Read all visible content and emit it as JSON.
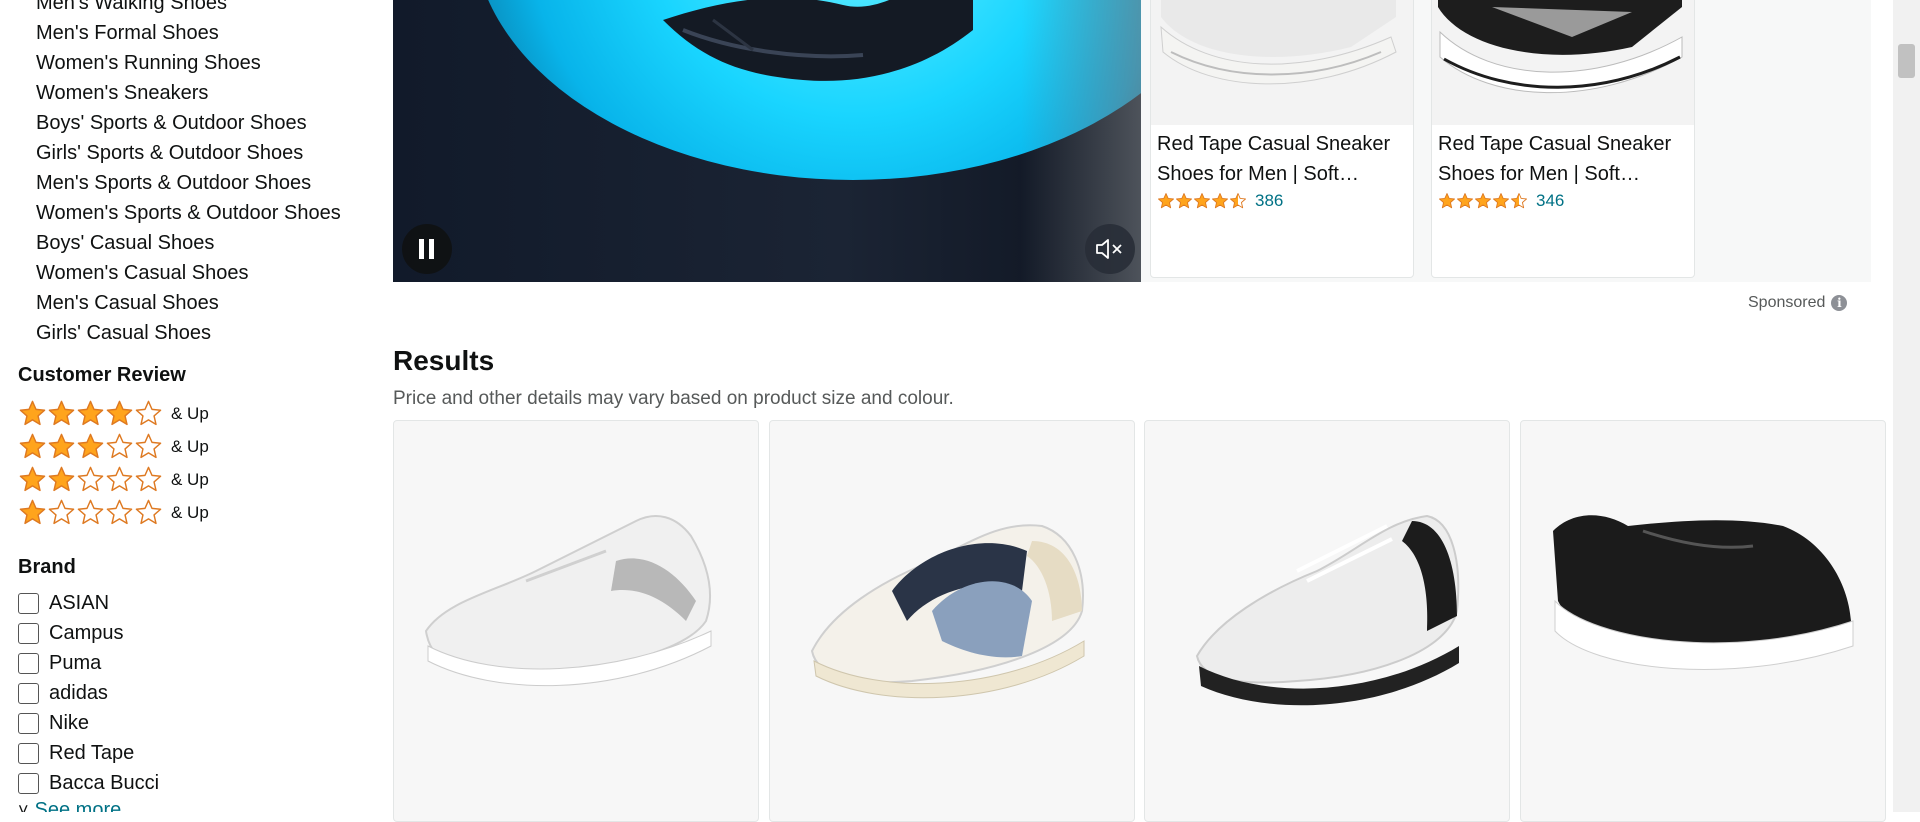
{
  "sidebar": {
    "categories": [
      "Men's Walking Shoes",
      "Men's Formal Shoes",
      "Women's Running Shoes",
      "Women's Sneakers",
      "Boys' Sports & Outdoor Shoes",
      "Girls' Sports & Outdoor Shoes",
      "Men's Sports & Outdoor Shoes",
      "Women's Sports & Outdoor Shoes",
      "Boys' Casual Shoes",
      "Women's Casual Shoes",
      "Men's Casual Shoes",
      "Girls' Casual Shoes"
    ],
    "customer_review": {
      "title": "Customer Review",
      "rows": [
        {
          "stars": 4,
          "label": "& Up"
        },
        {
          "stars": 3,
          "label": "& Up"
        },
        {
          "stars": 2,
          "label": "& Up"
        },
        {
          "stars": 1,
          "label": "& Up"
        }
      ]
    },
    "brand": {
      "title": "Brand",
      "items": [
        "ASIAN",
        "Campus",
        "Puma",
        "adidas",
        "Nike",
        "Red Tape",
        "Bacca Bucci"
      ],
      "see_more": "See more"
    }
  },
  "video": {
    "pause_icon": "pause-icon",
    "mute_icon": "muted-speaker-icon"
  },
  "sponsored_cards": [
    {
      "title_line1": "Red Tape Casual Sneaker",
      "title_line2": "Shoes for Men | Soft…",
      "rating": 4.5,
      "count": "386"
    },
    {
      "title_line1": "Red Tape Casual Sneaker",
      "title_line2": "Shoes for Men | Soft…",
      "rating": 4.5,
      "count": "346"
    }
  ],
  "sponsored_label": "Sponsored",
  "results": {
    "title": "Results",
    "subtitle": "Price and other details may vary based on product size and colour."
  },
  "products": [
    {
      "image": "white-grey-sneaker"
    },
    {
      "image": "white-navy-beige-sneaker"
    },
    {
      "image": "white-black-running-shoe"
    },
    {
      "image": "black-white-sneaker"
    }
  ],
  "colors": {
    "link": "#007185",
    "star": "#ffa41c",
    "star_outline": "#de7921"
  }
}
